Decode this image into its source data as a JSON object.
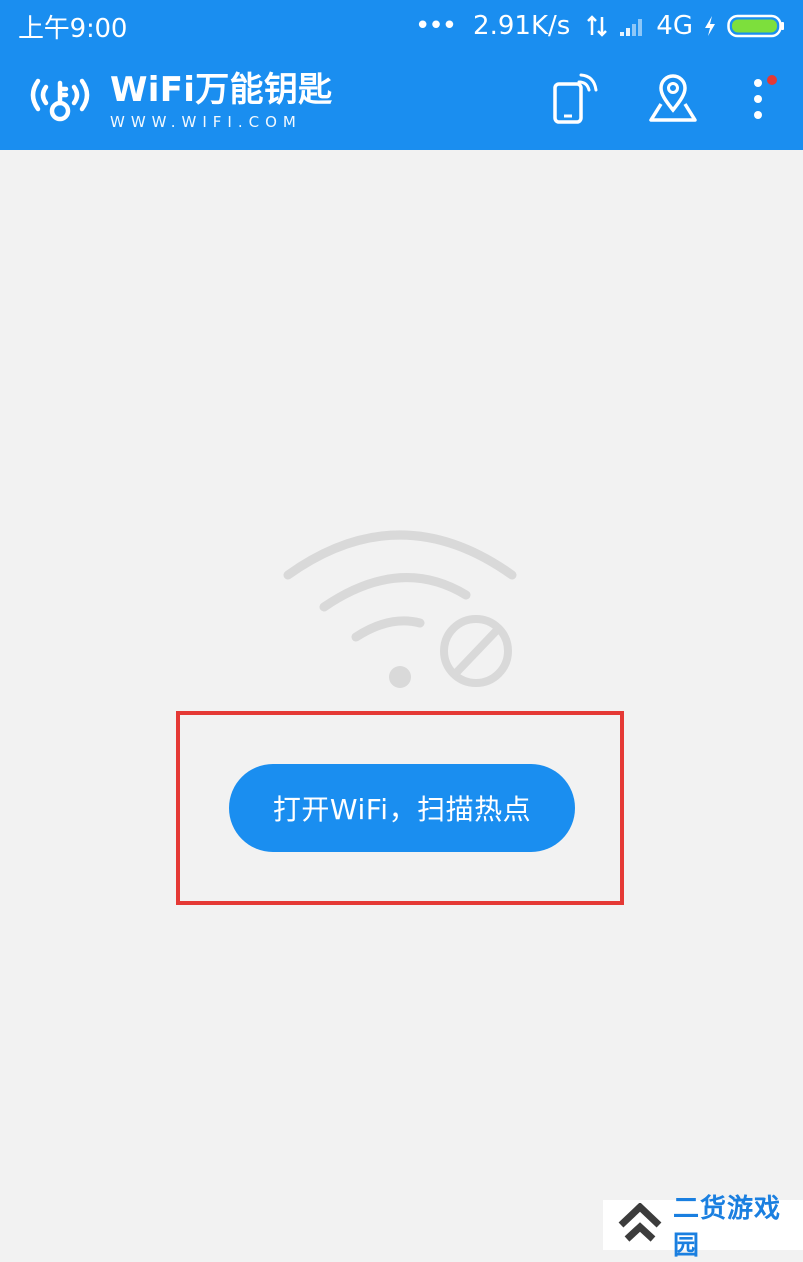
{
  "status_bar": {
    "time": "上午9:00",
    "dots": "•••",
    "speed": "2.91K/s",
    "network": "4G",
    "colors": {
      "background": "#1a8ef0",
      "text": "#ffffff",
      "battery": "#7ddf3c"
    },
    "icons": [
      "data-arrows-icon",
      "signal-icon",
      "charging-icon",
      "battery-icon"
    ]
  },
  "app_bar": {
    "title": "WiFi万能钥匙",
    "subtitle": "WWW.WIFI.COM",
    "icons": [
      "wifi-key-logo-icon",
      "phone-wifi-icon",
      "map-pin-icon",
      "more-vertical-icon"
    ],
    "has_notification": true
  },
  "main": {
    "empty_state_icon": "wifi-off-icon",
    "primary_button_label": "打开WiFi，扫描热点",
    "highlight_color": "#e53935"
  },
  "watermark": {
    "text": "二货游戏园",
    "icon": "double-chevron-up-icon"
  }
}
